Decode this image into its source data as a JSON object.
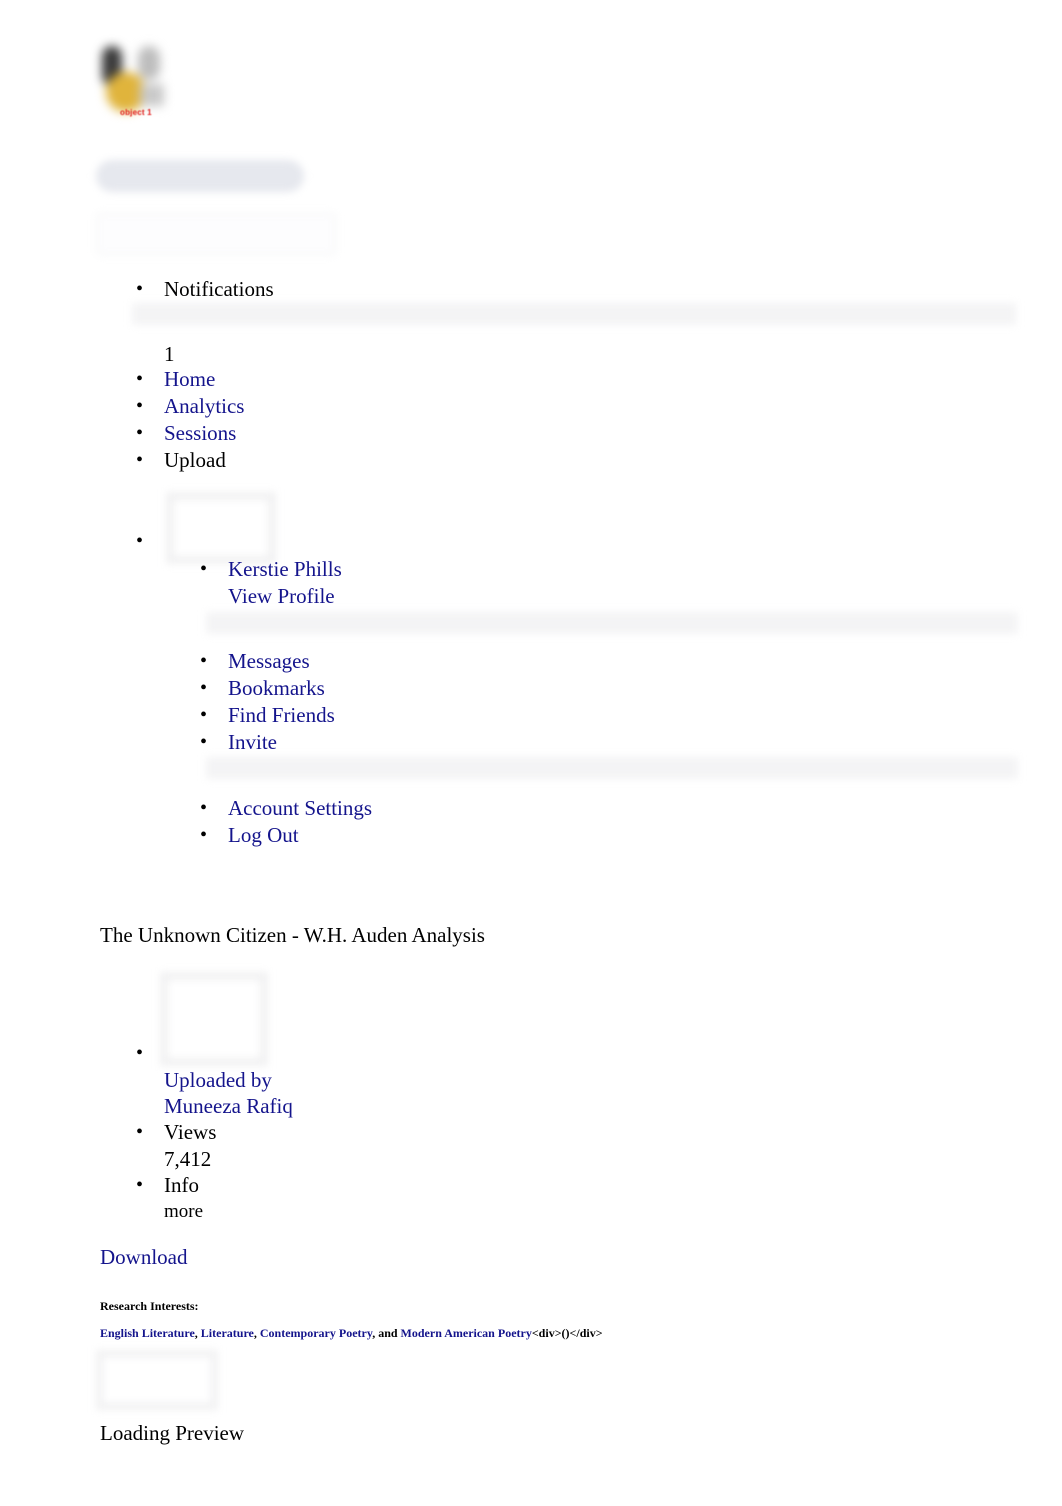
{
  "logo": {
    "caption": "object 1",
    "icon": "site-logo-image"
  },
  "search": {
    "primary_placeholder": "",
    "secondary_placeholder": ""
  },
  "nav": {
    "notifications_label": "Notifications",
    "notifications_count": "1",
    "items": [
      {
        "label": "Home",
        "link": true
      },
      {
        "label": "Analytics",
        "link": true
      },
      {
        "label": "Sessions",
        "link": true
      },
      {
        "label": "Upload",
        "link": false
      }
    ]
  },
  "user_menu": {
    "name": "Kerstie Phills",
    "view_profile": "View Profile",
    "links": [
      {
        "label": "Messages"
      },
      {
        "label": "Bookmarks"
      },
      {
        "label": "Find Friends"
      },
      {
        "label": "Invite"
      }
    ],
    "account_links": [
      {
        "label": "Account Settings"
      },
      {
        "label": "Log Out"
      }
    ]
  },
  "document": {
    "title": "The Unknown Citizen - W.H. Auden Analysis",
    "uploaded_by_label": "Uploaded by",
    "uploader": "Muneeza Rafiq",
    "views_label": "Views",
    "views_count": "7,412",
    "info_label": "Info",
    "info_more": "more",
    "download_label": "Download",
    "loading_preview": "Loading Preview"
  },
  "research_interests": {
    "heading": "Research Interests:",
    "tags": [
      "English Literature",
      "Literature",
      "Contemporary Poetry",
      "Modern American Poetry"
    ],
    "conjunction": "and",
    "trailing_raw": "<div>()</div>"
  },
  "colors": {
    "link": "#14148c",
    "text": "#000000",
    "placeholder_bar": "#f4f4f5",
    "search_fill": "#e6e8ee",
    "logo_caption": "#e01b1b"
  }
}
